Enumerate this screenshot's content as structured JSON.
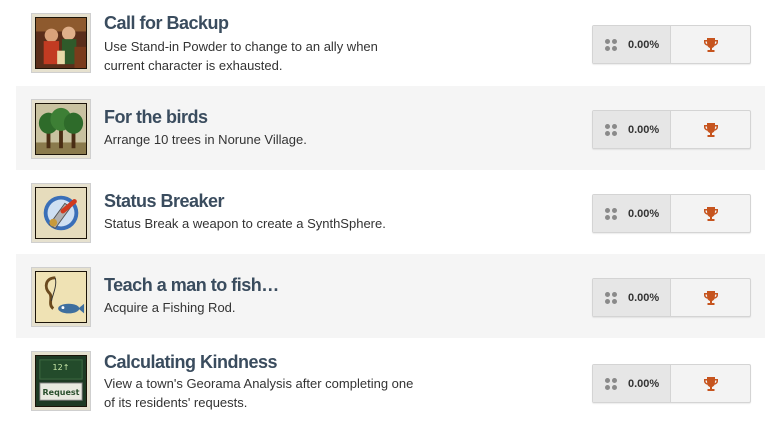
{
  "colors": {
    "title": "#3a4c5e",
    "description": "#333333",
    "trophy": "#c6541e",
    "row_alt_bg": "#f5f5f5"
  },
  "achievements": [
    {
      "title": "Call for Backup",
      "description": "Use Stand-in Powder to change to an ally when current character is exhausted.",
      "percent": "0.00%",
      "icon": "characters-portrait-icon",
      "trophy_icon": "trophy-icon"
    },
    {
      "title": "For the birds",
      "description": "Arrange 10 trees in Norune Village.",
      "percent": "0.00%",
      "icon": "trees-icon",
      "trophy_icon": "trophy-icon"
    },
    {
      "title": "Status Breaker",
      "description": "Status Break a weapon to create a SynthSphere.",
      "percent": "0.00%",
      "icon": "broken-sword-icon",
      "trophy_icon": "trophy-icon"
    },
    {
      "title": "Teach a man to fish…",
      "description": "Acquire a Fishing Rod.",
      "percent": "0.00%",
      "icon": "fishing-rod-icon",
      "trophy_icon": "trophy-icon"
    },
    {
      "title": "Calculating Kindness",
      "description": "View a town's Georama Analysis after completing one of its residents' requests.",
      "percent": "0.00%",
      "icon": "request-board-icon",
      "icon_text_top": "12↑",
      "icon_text_main": "Request",
      "trophy_icon": "trophy-icon"
    }
  ]
}
